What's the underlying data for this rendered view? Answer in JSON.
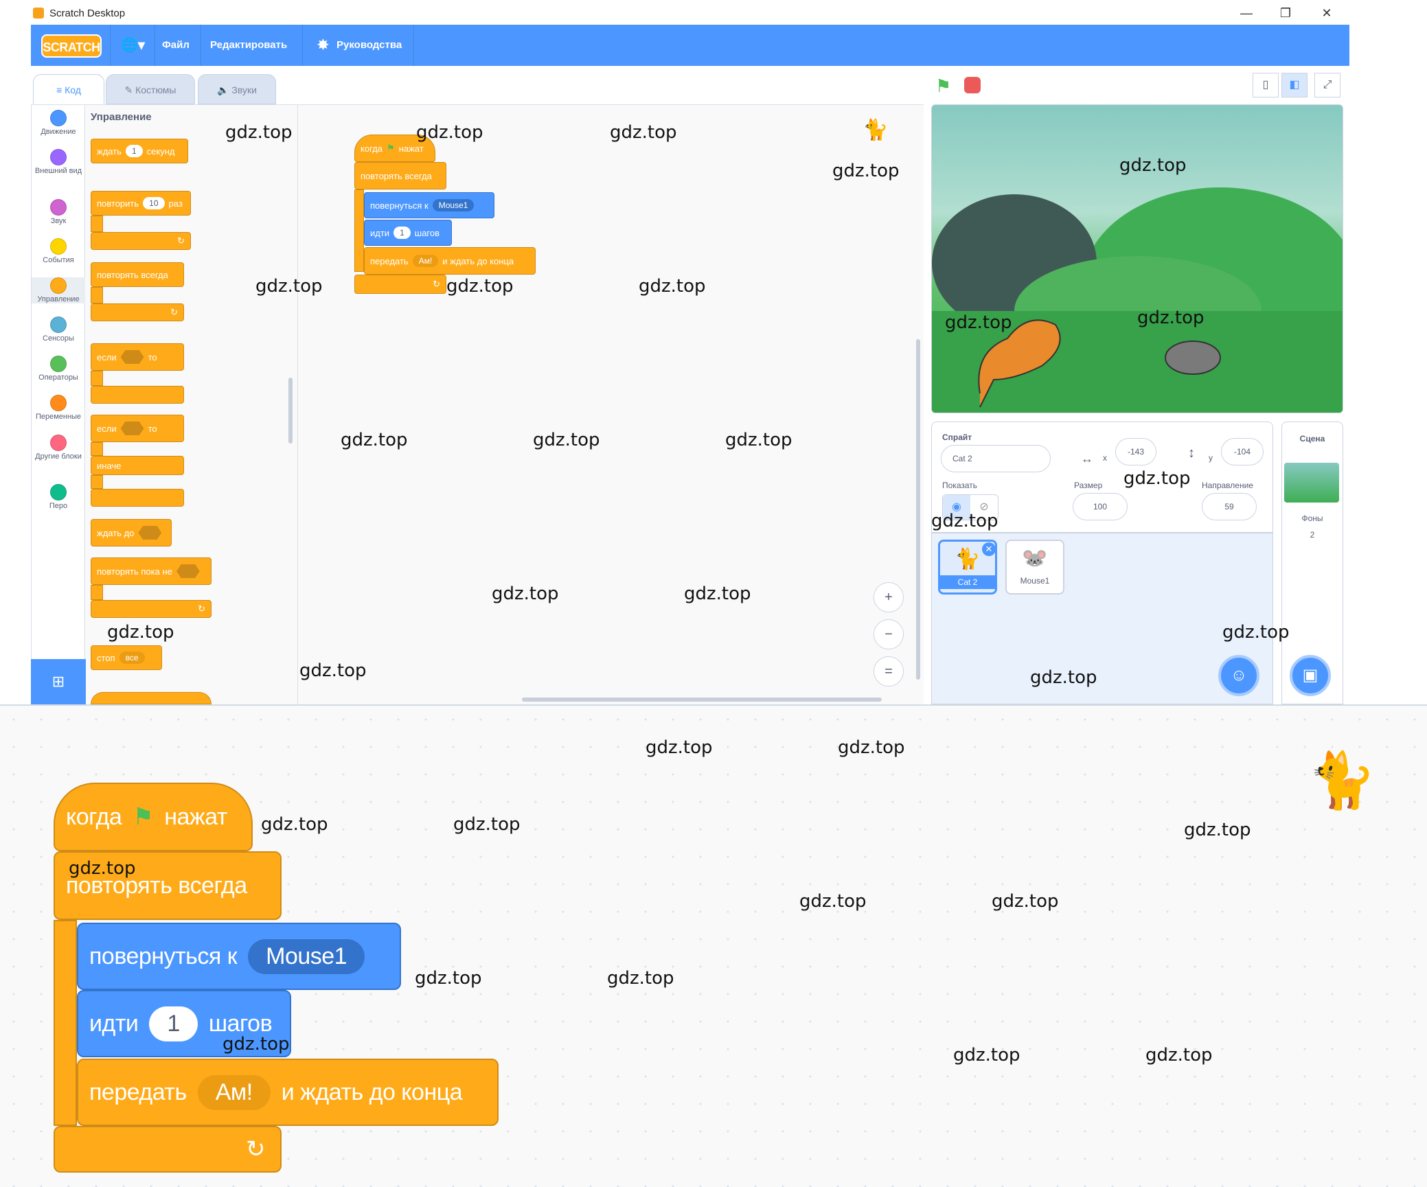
{
  "window": {
    "title": "Scratch Desktop",
    "minimize": "—",
    "maximize": "❐",
    "close": "✕"
  },
  "menubar": {
    "logo": "SCRATCH",
    "language_icon": "🌐▾",
    "file": "Файл",
    "edit": "Редактировать",
    "tutorials": "Руководства",
    "tutorials_icon": "✸"
  },
  "tabs": {
    "code": "Код",
    "costumes": "Костюмы",
    "sounds": "Звуки"
  },
  "categories": [
    {
      "label": "Движение",
      "color": "#4c97ff"
    },
    {
      "label": "Внешний вид",
      "color": "#9966ff"
    },
    {
      "label": "Звук",
      "color": "#cf63cf"
    },
    {
      "label": "События",
      "color": "#ffd500"
    },
    {
      "label": "Управление",
      "color": "#ffab19"
    },
    {
      "label": "Сенсоры",
      "color": "#5cb1d6"
    },
    {
      "label": "Операторы",
      "color": "#59c059"
    },
    {
      "label": "Переменные",
      "color": "#ff8c1a"
    },
    {
      "label": "Другие блоки",
      "color": "#ff6680"
    },
    {
      "label": "Перо",
      "color": "#0fbd8c"
    }
  ],
  "palette": {
    "title": "Управление",
    "wait": "ждать",
    "wait_value": "1",
    "wait_unit": "секунд",
    "repeat": "повторить",
    "repeat_value": "10",
    "repeat_unit": "раз",
    "forever": "повторять всегда",
    "if": "если",
    "then": "то",
    "if2": "если",
    "then2": "то",
    "else": "иначе",
    "wait_until": "ждать до",
    "repeat_until": "повторять пока не",
    "stop": "стоп",
    "stop_option": "все"
  },
  "script": {
    "when": "когда",
    "clicked": "нажат",
    "forever": "повторять всегда",
    "point_towards": "повернуться к",
    "target": "Mouse1",
    "move": "идти",
    "steps_value": "1",
    "steps": "шагов",
    "broadcast": "передать",
    "message": "Ам!",
    "and_wait": "и ждать до конца"
  },
  "zoom_controls": {
    "zoom_in": "+",
    "zoom_out": "−",
    "reset": "="
  },
  "sprite_info": {
    "sprite_label": "Спрайт",
    "sprite_name": "Cat 2",
    "x_label": "x",
    "x_value": "-143",
    "y_label": "y",
    "y_value": "-104",
    "show_label": "Показать",
    "size_label": "Размер",
    "size_value": "100",
    "direction_label": "Направление",
    "direction_value": "59"
  },
  "sprites": [
    {
      "name": "Cat 2",
      "selected": true
    },
    {
      "name": "Mouse1",
      "selected": false
    }
  ],
  "stage_panel": {
    "title": "Сцена",
    "backdrops_label": "Фоны",
    "backdrops_count": "2"
  },
  "watermark": "gdz.top"
}
